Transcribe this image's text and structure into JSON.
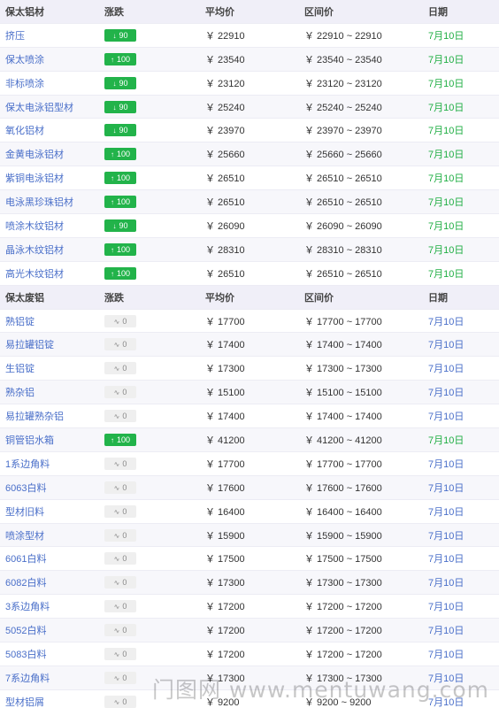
{
  "sections": [
    {
      "header": {
        "name": "保太铝材",
        "change": "涨跌",
        "avg": "平均价",
        "range": "区间价",
        "date": "日期"
      },
      "rows": [
        {
          "name": "挤压",
          "change": "90",
          "dir": "down",
          "avg": "￥ 22910",
          "range": "￥ 22910 ~ 22910",
          "date": "7月10日"
        },
        {
          "name": "保太喷涂",
          "change": "100",
          "dir": "up",
          "avg": "￥ 23540",
          "range": "￥ 23540 ~ 23540",
          "date": "7月10日"
        },
        {
          "name": "非标喷涂",
          "change": "90",
          "dir": "down",
          "avg": "￥ 23120",
          "range": "￥ 23120 ~ 23120",
          "date": "7月10日"
        },
        {
          "name": "保太电泳铝型材",
          "change": "90",
          "dir": "down",
          "avg": "￥ 25240",
          "range": "￥ 25240 ~ 25240",
          "date": "7月10日"
        },
        {
          "name": "氧化铝材",
          "change": "90",
          "dir": "down",
          "avg": "￥ 23970",
          "range": "￥ 23970 ~ 23970",
          "date": "7月10日"
        },
        {
          "name": "金黄电泳铝材",
          "change": "100",
          "dir": "up",
          "avg": "￥ 25660",
          "range": "￥ 25660 ~ 25660",
          "date": "7月10日"
        },
        {
          "name": "紫铜电泳铝材",
          "change": "100",
          "dir": "up",
          "avg": "￥ 26510",
          "range": "￥ 26510 ~ 26510",
          "date": "7月10日"
        },
        {
          "name": "电泳黑珍珠铝材",
          "change": "100",
          "dir": "up",
          "avg": "￥ 26510",
          "range": "￥ 26510 ~ 26510",
          "date": "7月10日"
        },
        {
          "name": "喷涂木纹铝材",
          "change": "90",
          "dir": "down",
          "avg": "￥ 26090",
          "range": "￥ 26090 ~ 26090",
          "date": "7月10日"
        },
        {
          "name": "晶泳木纹铝材",
          "change": "100",
          "dir": "up",
          "avg": "￥ 28310",
          "range": "￥ 28310 ~ 28310",
          "date": "7月10日"
        },
        {
          "name": "高光木纹铝材",
          "change": "100",
          "dir": "up",
          "avg": "￥ 26510",
          "range": "￥ 26510 ~ 26510",
          "date": "7月10日"
        }
      ]
    },
    {
      "header": {
        "name": "保太废铝",
        "change": "涨跌",
        "avg": "平均价",
        "range": "区间价",
        "date": "日期"
      },
      "rows": [
        {
          "name": "熟铝锭",
          "change": "0",
          "dir": "flat",
          "avg": "￥ 17700",
          "range": "￥ 17700 ~ 17700",
          "date": "7月10日"
        },
        {
          "name": "易拉罐铝锭",
          "change": "0",
          "dir": "flat",
          "avg": "￥ 17400",
          "range": "￥ 17400 ~ 17400",
          "date": "7月10日"
        },
        {
          "name": "生铝锭",
          "change": "0",
          "dir": "flat",
          "avg": "￥ 17300",
          "range": "￥ 17300 ~ 17300",
          "date": "7月10日"
        },
        {
          "name": "熟杂铝",
          "change": "0",
          "dir": "flat",
          "avg": "￥ 15100",
          "range": "￥ 15100 ~ 15100",
          "date": "7月10日"
        },
        {
          "name": "易拉罐熟杂铝",
          "change": "0",
          "dir": "flat",
          "avg": "￥ 17400",
          "range": "￥ 17400 ~ 17400",
          "date": "7月10日"
        },
        {
          "name": "铜管铝水箱",
          "change": "100",
          "dir": "up",
          "avg": "￥ 41200",
          "range": "￥ 41200 ~ 41200",
          "date": "7月10日"
        },
        {
          "name": "1系边角料",
          "change": "0",
          "dir": "flat",
          "avg": "￥ 17700",
          "range": "￥ 17700 ~ 17700",
          "date": "7月10日"
        },
        {
          "name": "6063白料",
          "change": "0",
          "dir": "flat",
          "avg": "￥ 17600",
          "range": "￥ 17600 ~ 17600",
          "date": "7月10日"
        },
        {
          "name": "型材旧料",
          "change": "0",
          "dir": "flat",
          "avg": "￥ 16400",
          "range": "￥ 16400 ~ 16400",
          "date": "7月10日"
        },
        {
          "name": "喷涂型材",
          "change": "0",
          "dir": "flat",
          "avg": "￥ 15900",
          "range": "￥ 15900 ~ 15900",
          "date": "7月10日"
        },
        {
          "name": "6061白料",
          "change": "0",
          "dir": "flat",
          "avg": "￥ 17500",
          "range": "￥ 17500 ~ 17500",
          "date": "7月10日"
        },
        {
          "name": "6082白料",
          "change": "0",
          "dir": "flat",
          "avg": "￥ 17300",
          "range": "￥ 17300 ~ 17300",
          "date": "7月10日"
        },
        {
          "name": "3系边角料",
          "change": "0",
          "dir": "flat",
          "avg": "￥ 17200",
          "range": "￥ 17200 ~ 17200",
          "date": "7月10日"
        },
        {
          "name": "5052白料",
          "change": "0",
          "dir": "flat",
          "avg": "￥ 17200",
          "range": "￥ 17200 ~ 17200",
          "date": "7月10日"
        },
        {
          "name": "5083白料",
          "change": "0",
          "dir": "flat",
          "avg": "￥ 17200",
          "range": "￥ 17200 ~ 17200",
          "date": "7月10日"
        },
        {
          "name": "7系边角料",
          "change": "0",
          "dir": "flat",
          "avg": "￥ 17300",
          "range": "￥ 17300 ~ 17300",
          "date": "7月10日"
        },
        {
          "name": "型材铝屑",
          "change": "0",
          "dir": "flat",
          "avg": "￥ 9200",
          "range": "￥ 9200 ~ 9200",
          "date": "7月10日"
        }
      ]
    }
  ],
  "glyphs": {
    "up": "↑",
    "down": "↓",
    "flat": "∿"
  },
  "colors": {
    "up_badge": "#22b34a",
    "flat_badge": "#efefef",
    "date_green": "#1fae43",
    "link_blue": "#4a6fc9",
    "header_bg": "#f0eff8"
  },
  "watermark": "门图网 www.mentuwang.com"
}
